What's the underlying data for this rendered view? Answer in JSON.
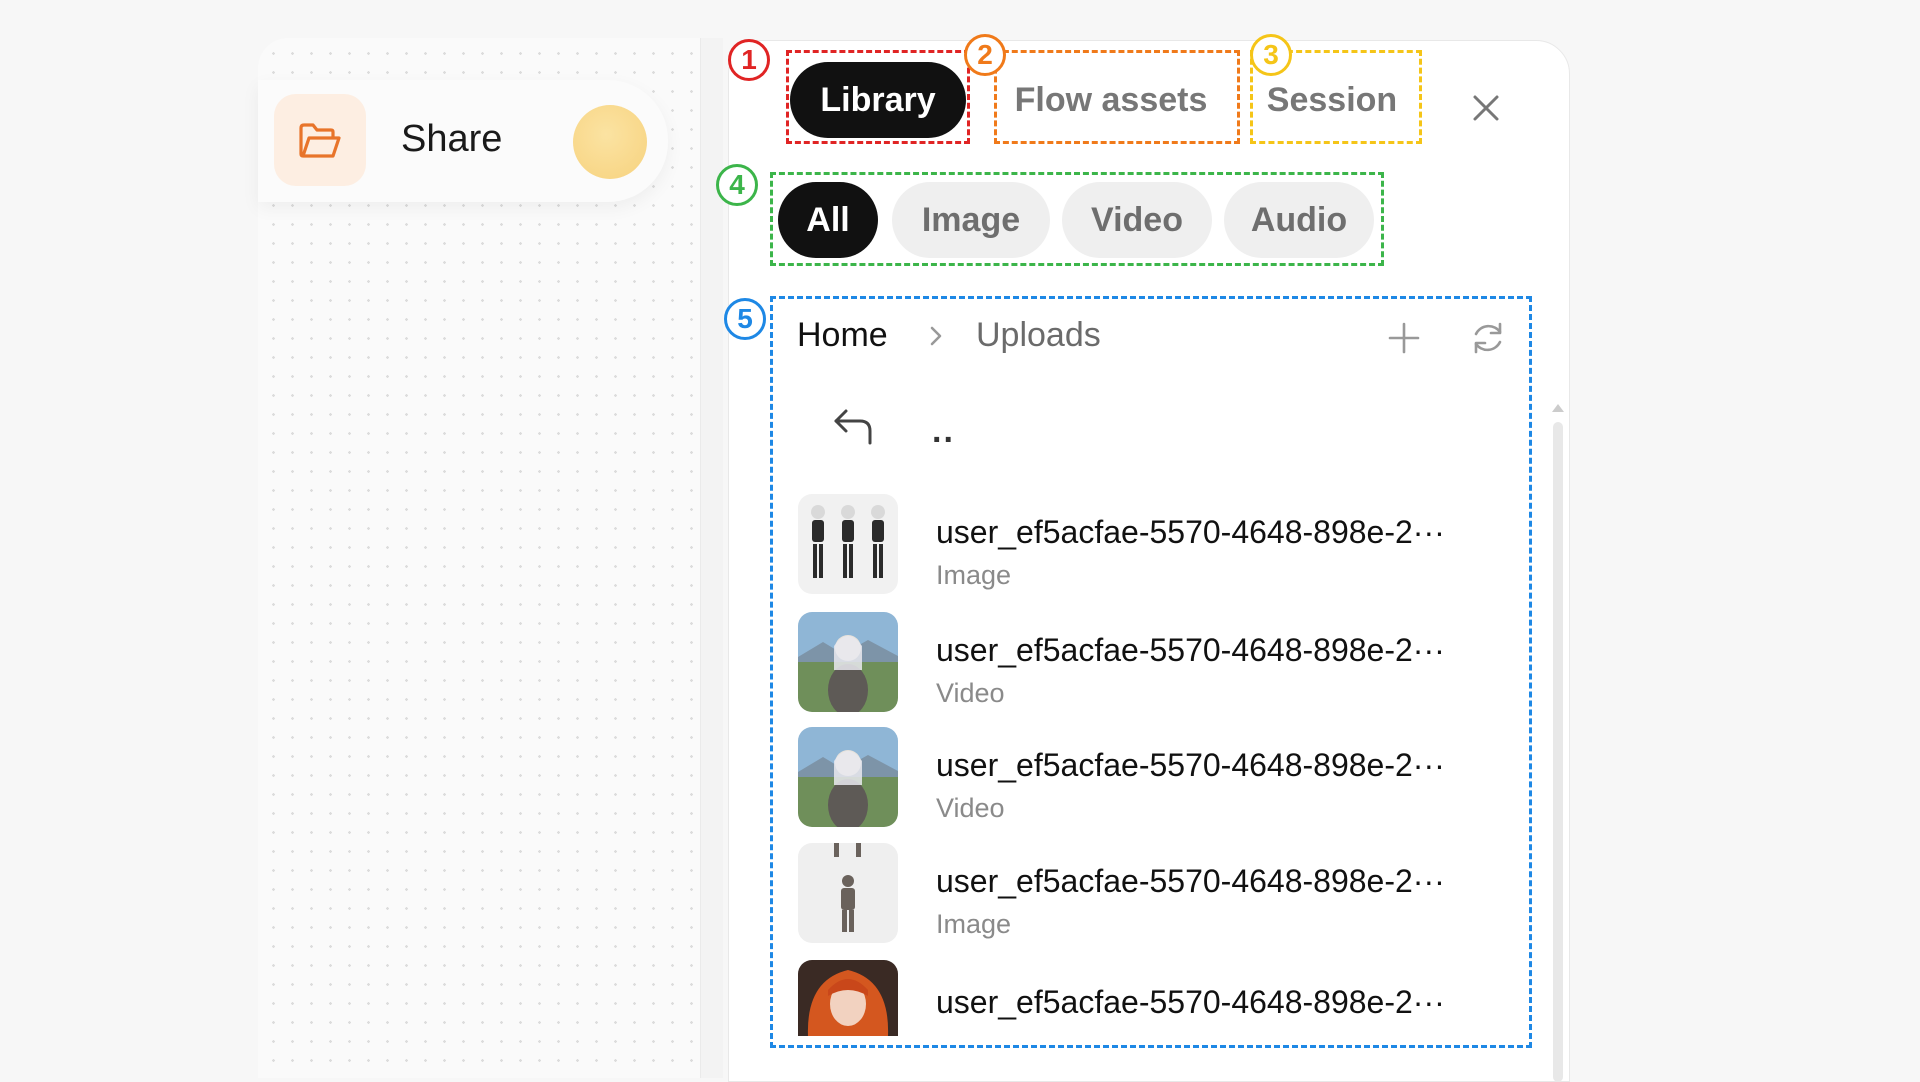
{
  "left": {
    "share_label": "Share"
  },
  "tabs": [
    {
      "label": "Library",
      "active": true
    },
    {
      "label": "Flow assets",
      "active": false
    },
    {
      "label": "Session",
      "active": false
    }
  ],
  "filters": [
    {
      "label": "All",
      "active": true
    },
    {
      "label": "Image",
      "active": false
    },
    {
      "label": "Video",
      "active": false
    },
    {
      "label": "Audio",
      "active": false
    }
  ],
  "breadcrumb": {
    "home": "Home",
    "current": "Uploads"
  },
  "parent_dir": "..",
  "files": [
    {
      "name": "user_ef5acfae-5570-4648-898e-2···",
      "type": "Image",
      "thumb": "character-sheet-light"
    },
    {
      "name": "user_ef5acfae-5570-4648-898e-2···",
      "type": "Video",
      "thumb": "warrior-landscape"
    },
    {
      "name": "user_ef5acfae-5570-4648-898e-2···",
      "type": "Video",
      "thumb": "warrior-landscape"
    },
    {
      "name": "user_ef5acfae-5570-4648-898e-2···",
      "type": "Image",
      "thumb": "character-sheet-light"
    },
    {
      "name": "user_ef5acfae-5570-4648-898e-2···",
      "type": "",
      "thumb": "redhead-portrait"
    }
  ],
  "annotations": [
    {
      "number": "1",
      "color": "#e02424"
    },
    {
      "number": "2",
      "color": "#f07a1a"
    },
    {
      "number": "3",
      "color": "#f5c518"
    },
    {
      "number": "4",
      "color": "#3cb54a"
    },
    {
      "number": "5",
      "color": "#1e88e5"
    }
  ],
  "colors": {
    "active_tab_bg": "#111111",
    "chip_bg": "#efefef",
    "folder_accent": "#e8742a"
  },
  "icons": [
    "folder-icon",
    "close-icon",
    "chevron-right-icon",
    "plus-icon",
    "refresh-icon",
    "back-arrow-icon"
  ]
}
